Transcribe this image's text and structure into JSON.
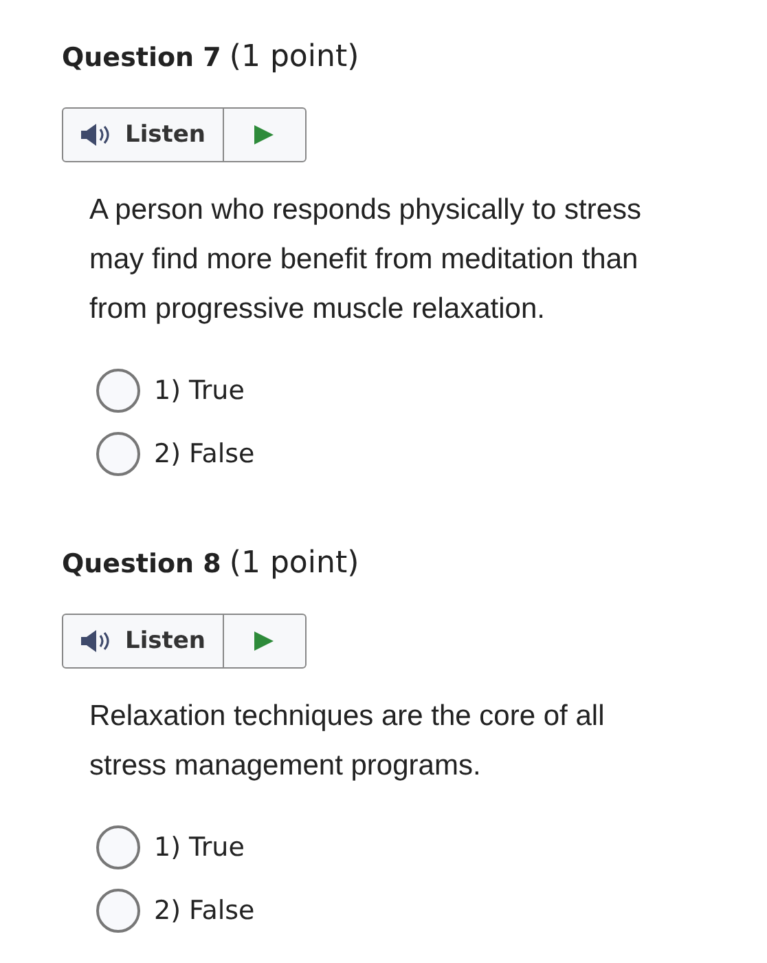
{
  "questions": [
    {
      "title": "Question 7",
      "points": "(1 point)",
      "listen": "Listen",
      "text": "A person who responds physically to stress may find more benefit from meditation than from progressive muscle relaxation.",
      "options": [
        {
          "label": "1) True",
          "selected": false
        },
        {
          "label": "2) False",
          "selected": false
        }
      ]
    },
    {
      "title": "Question 8",
      "points": "(1 point)",
      "listen": "Listen",
      "text": "Relaxation techniques are the core of all stress management programs.",
      "options": [
        {
          "label": "1) True",
          "selected": false
        },
        {
          "label": "2) False",
          "selected": false
        }
      ]
    }
  ]
}
